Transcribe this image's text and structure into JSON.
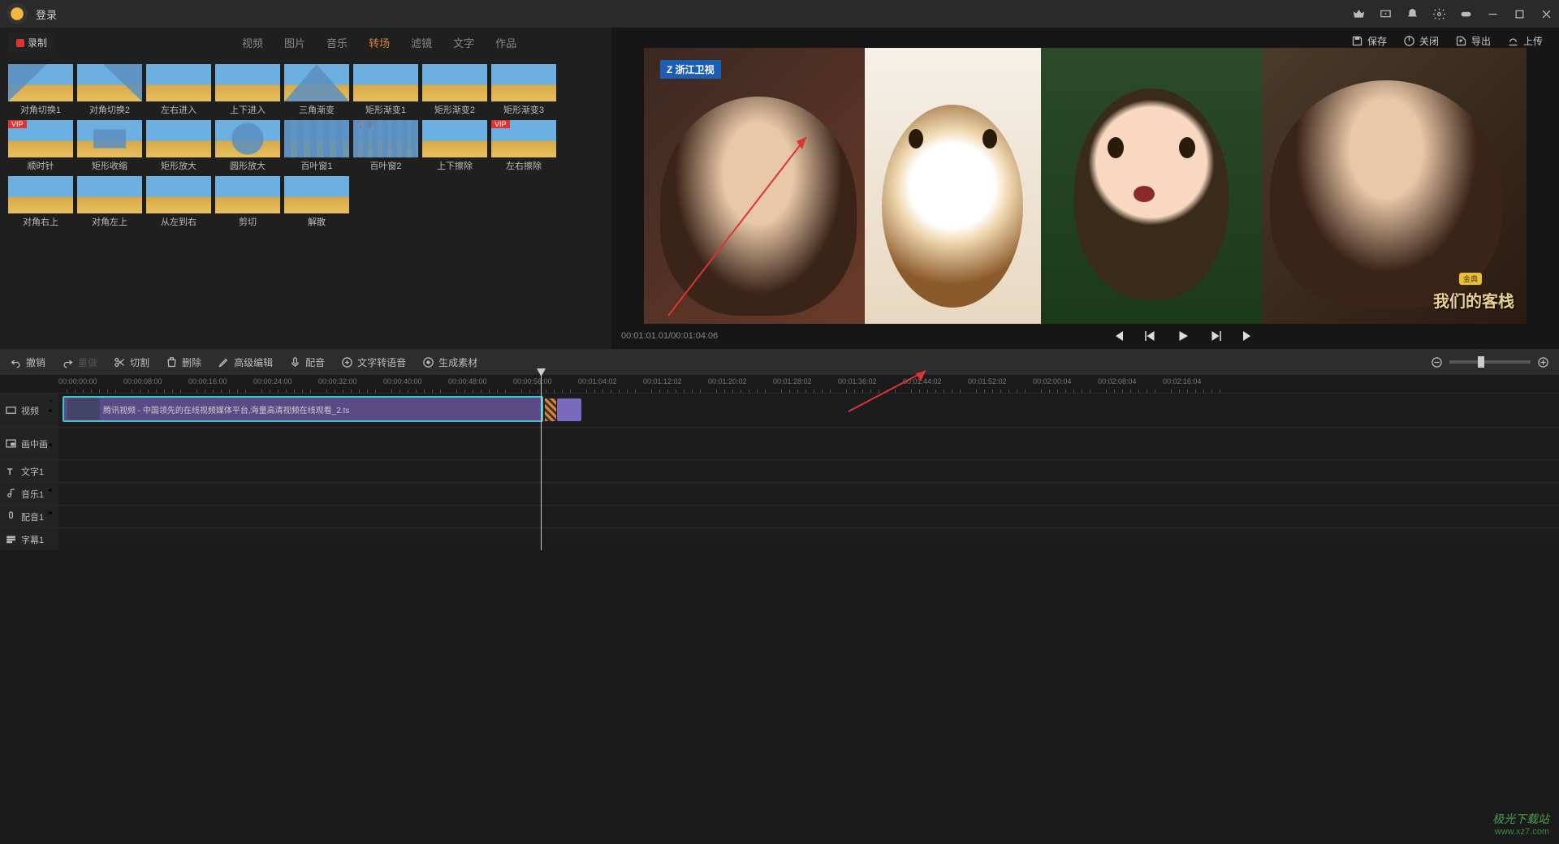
{
  "titlebar": {
    "login": "登录"
  },
  "header": {
    "save": "保存",
    "close": "关闭",
    "export": "导出",
    "upload": "上传"
  },
  "record": {
    "label": "录制"
  },
  "tabs": [
    "视频",
    "图片",
    "音乐",
    "转场",
    "滤镜",
    "文字",
    "作品"
  ],
  "active_tab_index": 3,
  "transitions": [
    {
      "label": "对角切换1"
    },
    {
      "label": "对角切换2"
    },
    {
      "label": "左右进入"
    },
    {
      "label": "上下进入"
    },
    {
      "label": "三角渐变"
    },
    {
      "label": "矩形渐变1"
    },
    {
      "label": "矩形渐变2"
    },
    {
      "label": "矩形渐变3"
    },
    {
      "label": "顺时针",
      "vip": true
    },
    {
      "label": "矩形收缩"
    },
    {
      "label": "矩形放大"
    },
    {
      "label": "圆形放大"
    },
    {
      "label": "百叶窗1"
    },
    {
      "label": "百叶窗2",
      "vip": true
    },
    {
      "label": "上下擦除"
    },
    {
      "label": "左右擦除",
      "vip": true
    },
    {
      "label": "对角右上"
    },
    {
      "label": "对角左上"
    },
    {
      "label": "从左到右"
    },
    {
      "label": "剪切"
    },
    {
      "label": "解散"
    }
  ],
  "preview": {
    "time": "00:01:01.01/00:01:04:06"
  },
  "toolbar": {
    "undo": "撤销",
    "redo": "重做",
    "cut": "切割",
    "delete": "删除",
    "advanced_edit": "高级编辑",
    "dub": "配音",
    "tts": "文字转语音",
    "gen": "生成素材"
  },
  "ruler_ticks": [
    "00:00:00:00",
    "00:00:08:00",
    "00:00:16:00",
    "00:00:24:00",
    "00:00:32:00",
    "00:00:40:00",
    "00:00:48:00",
    "00:00:56:00",
    "00:01:04:02",
    "00:01:12:02",
    "00:01:20:02",
    "00:01:28:02",
    "00:01:36:02",
    "00:01:44:02",
    "00:01:52:02",
    "00:02:00:04",
    "00:02:08:04",
    "00:02:16:04"
  ],
  "tracks": {
    "video": "视频",
    "pip": "画中画",
    "text": "文字1",
    "music": "音乐1",
    "voice": "配音1",
    "sub": "字幕1"
  },
  "clip": {
    "name": "腾讯视频 - 中国领先的在线视频媒体平台,海量高清视频在线观看_2.ts"
  },
  "watermark": {
    "brand": "极光下载站",
    "url": "www.xz7.com"
  }
}
